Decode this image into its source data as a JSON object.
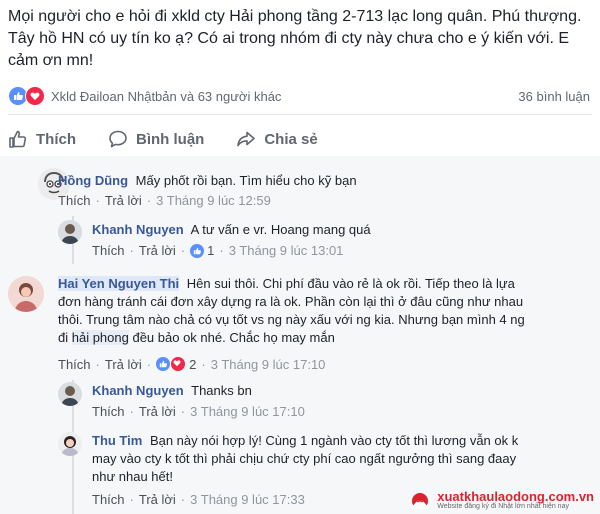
{
  "post": {
    "text": "Mọi người cho e hỏi đi xkld cty Hải phong tầng 2-713 lạc long quân. Phú thượng. Tây hồ HN có uy tín ko ạ? Có ai trong nhóm đi cty này chưa cho e ý kiến với. E cảm ơn mn!",
    "reactions_text": "Xkld Đailoan Nhậtbản và 63 người khác",
    "comments_count": "36 bình luận"
  },
  "actions": {
    "like": "Thích",
    "comment": "Bình luận",
    "share": "Chia sẻ"
  },
  "comments": [
    {
      "name": "Hồng Dũng",
      "text": "Mấy phốt rồi bạn. Tìm hiểu cho kỹ bạn",
      "like": "Thích",
      "reply": "Trả lời",
      "time": "3 Tháng 9 lúc 12:59",
      "replies": [
        {
          "name": "Khanh Nguyen",
          "text": "A tư vấn e vr. Hoang mang quá",
          "like": "Thích",
          "reply": "Trả lời",
          "reaction_count": "1",
          "time": "3 Tháng 9 lúc 13:01"
        }
      ]
    },
    {
      "name": "Hai Yen Nguyen Thi",
      "text_before": "Hên sui thôi. Chi phí đầu vào rẻ là ok rồi. Tiếp theo là lựa đơn hàng tránh cái đơn xây dựng ra là ok. Phần còn lại thì ở đâu cũng như nhau thôi. Trung tâm nào chả có vụ tốt vs ng này xấu với ng kia. Nhưng bạn mình 4 ng đi ",
      "mention": "hải phong",
      "text_after": " đều bảo ok nhé. Chắc họ may mắn",
      "like": "Thích",
      "reply": "Trả lời",
      "reaction_count": "2",
      "time": "3 Tháng 9 lúc 17:10",
      "replies": [
        {
          "name": "Khanh Nguyen",
          "text": "Thanks bn",
          "like": "Thích",
          "reply": "Trả lời",
          "time": "3 Tháng 9 lúc 17:10"
        },
        {
          "name": "Thu Tim",
          "text": "Bạn này nói hợp lý! Cùng 1 ngành vào cty tốt thì lương vẫn ok k may vào cty k tốt thì phải chịu chứ cty phí cao ngất ngưởng thì sang đaay như nhau hết!",
          "like": "Thích",
          "reply": "Trả lời",
          "time": "3 Tháng 9 lúc 17:33"
        }
      ]
    }
  ],
  "watermark": {
    "name": "xuatkhaulaodong.com.vn",
    "tagline": "Website đăng ký đi Nhật lớn nhất hiện nay"
  },
  "colors": {
    "link": "#385898",
    "like": "#5890ff",
    "love": "#f0284a",
    "meta": "#90949c",
    "brand": "#d9232d"
  }
}
